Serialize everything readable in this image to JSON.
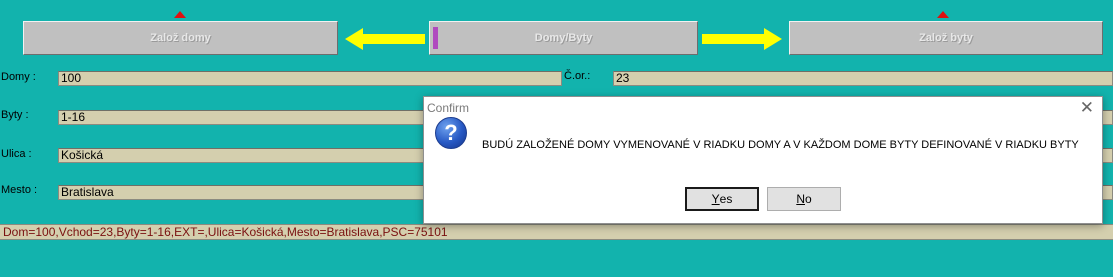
{
  "toolbar": {
    "create_houses_label": "Založ domy",
    "houses_flats_label": "Domy/Byty",
    "create_flats_label": "Založ byty"
  },
  "form": {
    "houses_label": "Domy :",
    "houses_value": "100",
    "entrance_label": "Č.or.:",
    "entrance_value": "23",
    "flats_label": "Byty :",
    "flats_value": "1-16",
    "street_label": "Ulica :",
    "street_value": "Košická",
    "city_label": "Mesto :",
    "city_value": "Bratislava"
  },
  "status": {
    "text": "Dom=100,Vchod=23,Byty=1-16,EXT=,Ulica=Košická,Mesto=Bratislava,PSC=75101"
  },
  "dialog": {
    "title": "Confirm",
    "close_glyph": "✕",
    "icon_glyph": "?",
    "message": "BUDÚ ZALOŽENÉ DOMY VYMENOVANÉ V RIADKU DOMY A V KAŽDOM DOME BYTY DEFINOVANÉ V RIADKU BYTY",
    "yes_first": "Y",
    "yes_rest": "es",
    "no_first": "N",
    "no_rest": "o"
  },
  "colors": {
    "background": "#12b3ad",
    "field": "#d4cfae",
    "arrow": "#ffff00",
    "marker": "#e01010",
    "focus_bar": "#b04abf"
  }
}
